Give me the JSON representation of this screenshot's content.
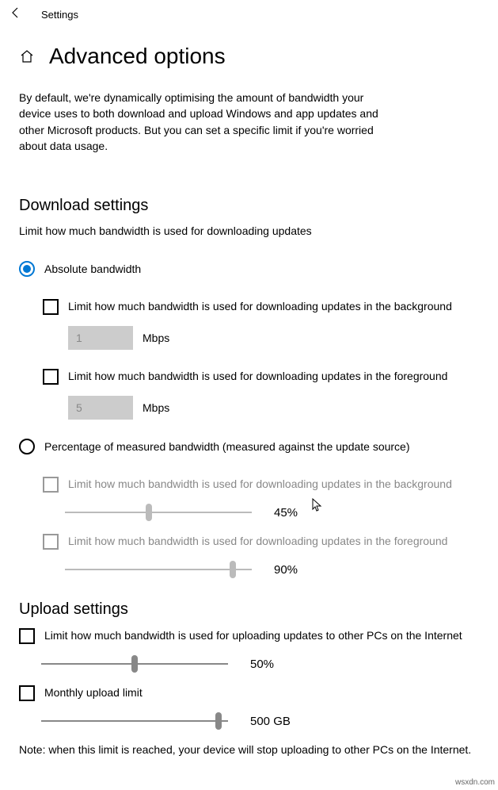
{
  "titlebar": {
    "label": "Settings"
  },
  "page": {
    "title": "Advanced options",
    "intro": "By default, we're dynamically optimising the amount of bandwidth your device uses to both download and upload Windows and app updates and other Microsoft products. But you can set a specific limit if you're worried about data usage."
  },
  "download": {
    "heading": "Download settings",
    "sub": "Limit how much bandwidth is used for downloading updates",
    "absolute": {
      "label": "Absolute bandwidth",
      "bg_check": "Limit how much bandwidth is used for downloading updates in the background",
      "bg_value": "1",
      "bg_unit": "Mbps",
      "fg_check": "Limit how much bandwidth is used for downloading updates in the foreground",
      "fg_value": "5",
      "fg_unit": "Mbps"
    },
    "percentage": {
      "label": "Percentage of measured bandwidth (measured against the update source)",
      "bg_check": "Limit how much bandwidth is used for downloading updates in the background",
      "bg_value": "45%",
      "bg_percent": 45,
      "fg_check": "Limit how much bandwidth is used for downloading updates in the foreground",
      "fg_value": "90%",
      "fg_percent": 90
    }
  },
  "upload": {
    "heading": "Upload settings",
    "limit_check": "Limit how much bandwidth is used for uploading updates to other PCs on the Internet",
    "limit_value": "50%",
    "limit_percent": 50,
    "monthly_check": "Monthly upload limit",
    "monthly_value": "500 GB",
    "monthly_percent": 95,
    "note": "Note: when this limit is reached, your device will stop uploading to other PCs on the Internet."
  },
  "watermark": "wsxdn.com"
}
